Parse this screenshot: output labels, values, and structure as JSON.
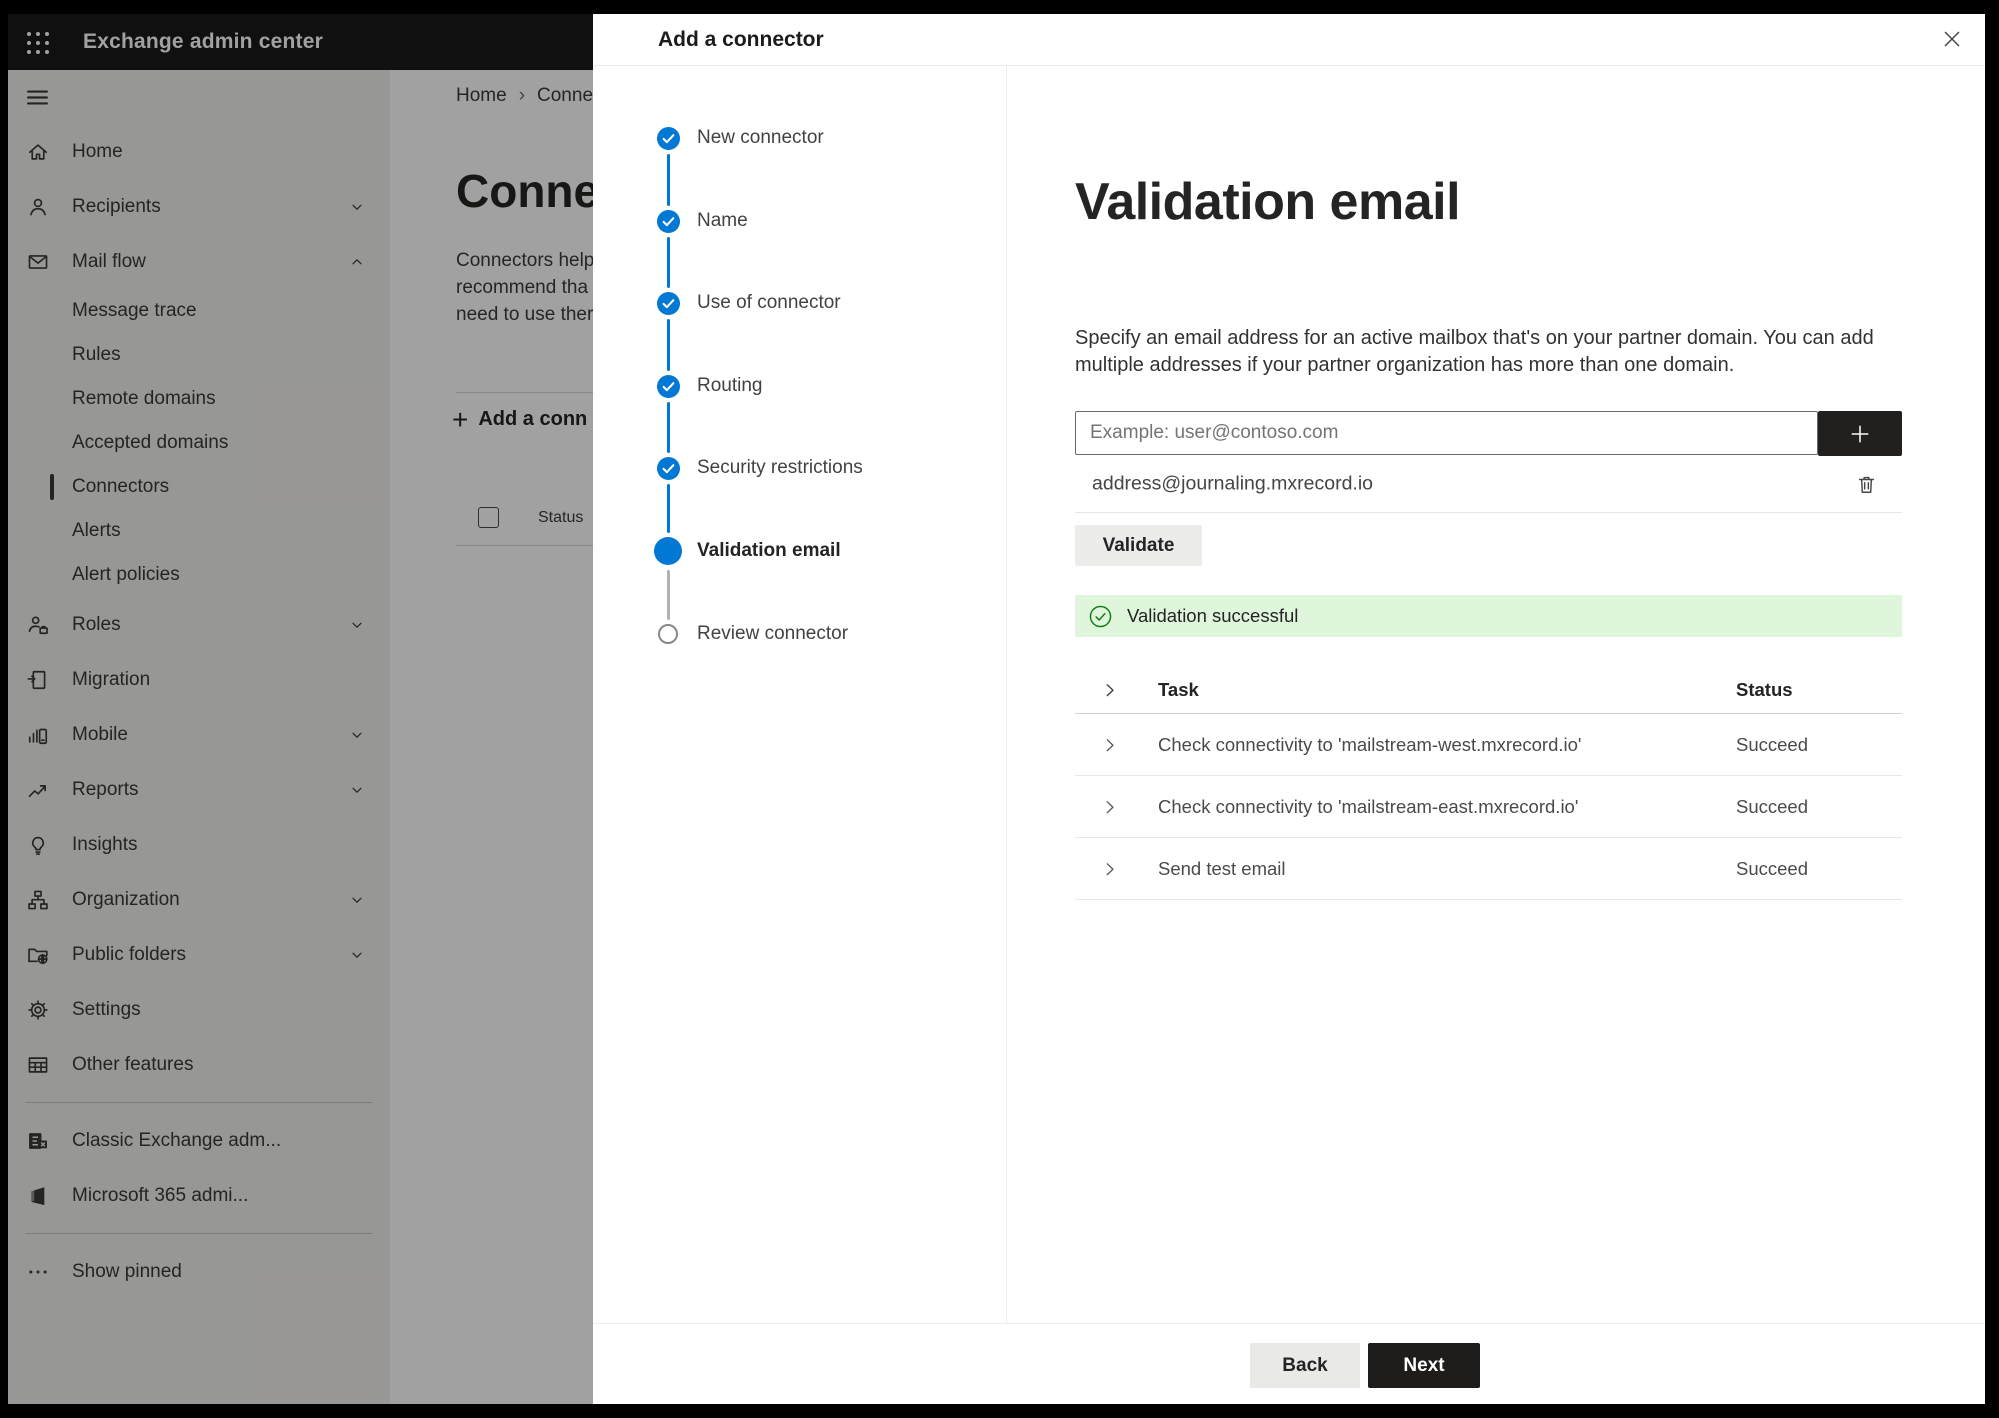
{
  "top_bar": {
    "title": "Exchange admin center"
  },
  "sidebar": {
    "items": [
      {
        "label": "Home",
        "icon": "home"
      },
      {
        "label": "Recipients",
        "icon": "person",
        "expandable": true
      },
      {
        "label": "Mail flow",
        "icon": "mail",
        "expandable": true,
        "expanded": true
      },
      {
        "label": "Roles",
        "icon": "person-briefcase",
        "expandable": true
      },
      {
        "label": "Migration",
        "icon": "document-arrow"
      },
      {
        "label": "Mobile",
        "icon": "bars-phone",
        "expandable": true
      },
      {
        "label": "Reports",
        "icon": "line-chart",
        "expandable": true
      },
      {
        "label": "Insights",
        "icon": "lightbulb"
      },
      {
        "label": "Organization",
        "icon": "org-chart",
        "expandable": true
      },
      {
        "label": "Public folders",
        "icon": "folder-globe",
        "expandable": true
      },
      {
        "label": "Settings",
        "icon": "gear"
      },
      {
        "label": "Other features",
        "icon": "table-grid"
      },
      {
        "label": "Classic Exchange adm...",
        "icon": "exchange-logo"
      },
      {
        "label": "Microsoft 365 admi...",
        "icon": "office-logo"
      },
      {
        "label": "Show pinned",
        "icon": "ellipsis"
      }
    ],
    "mail_flow_children": [
      {
        "label": "Message trace"
      },
      {
        "label": "Rules"
      },
      {
        "label": "Remote domains"
      },
      {
        "label": "Accepted domains"
      },
      {
        "label": "Connectors",
        "selected": true
      },
      {
        "label": "Alerts"
      },
      {
        "label": "Alert policies"
      }
    ]
  },
  "background": {
    "breadcrumb_home": "Home",
    "breadcrumb_current": "Conne",
    "page_title": "Connec",
    "intro_lines": [
      "Connectors help",
      "recommend tha",
      "need to use ther"
    ],
    "add_connector_button": "Add a conn",
    "status_column": "Status"
  },
  "dialog": {
    "title": "Add a connector",
    "steps": [
      {
        "label": "New connector",
        "state": "done"
      },
      {
        "label": "Name",
        "state": "done"
      },
      {
        "label": "Use of connector",
        "state": "done"
      },
      {
        "label": "Routing",
        "state": "done"
      },
      {
        "label": "Security restrictions",
        "state": "done"
      },
      {
        "label": "Validation email",
        "state": "current"
      },
      {
        "label": "Review connector",
        "state": "pending"
      }
    ],
    "heading": "Validation email",
    "description": "Specify an email address for an active mailbox that's on your partner domain. You can add multiple addresses if your partner organization has more than one domain.",
    "email_input": {
      "value": "",
      "placeholder": "Example: user@contoso.com"
    },
    "added_address": "address@journaling.mxrecord.io",
    "validate_button": "Validate",
    "success_message": "Validation successful",
    "table": {
      "columns": [
        "Task",
        "Status"
      ],
      "rows": [
        {
          "task": "Check connectivity to 'mailstream-west.mxrecord.io'",
          "status": "Succeed"
        },
        {
          "task": "Check connectivity to 'mailstream-east.mxrecord.io'",
          "status": "Succeed"
        },
        {
          "task": "Send test email",
          "status": "Succeed"
        }
      ]
    },
    "back_button": "Back",
    "next_button": "Next"
  },
  "icons": {
    "app-launcher": "waffle-grid",
    "hamburger": "menu-lines",
    "close": "x",
    "add-address": "plus",
    "delete-address": "trash",
    "success": "check-circle-outline",
    "step-complete": "check-circle-filled",
    "expand-row": "chevron-right",
    "breadcrumb-separator": "chevron-right"
  },
  "colors": {
    "accent": "#0078d4",
    "success_background": "#dff6dd",
    "success_green": "#107c10",
    "top_bar": "#1a1a1a",
    "primary_button": "#1e1d1c"
  }
}
